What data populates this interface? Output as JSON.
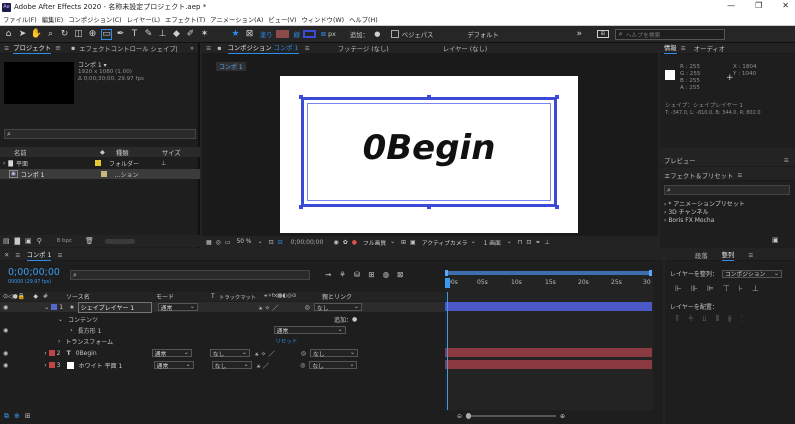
{
  "titlebar": {
    "app_icon": "Ae",
    "title": "Adobe After Effects 2020 - 名称未設定プロジェクト.aep *",
    "minimize": "—",
    "maximize": "❐",
    "close": "✕"
  },
  "menu": [
    "ファイル(F)",
    "編集(E)",
    "コンポジション(C)",
    "レイヤー(L)",
    "エフェクト(T)",
    "アニメーション(A)",
    "ビュー(V)",
    "ウィンドウ(W)",
    "ヘルプ(H)"
  ],
  "toolbar": {
    "fill_label": "塗り",
    "stroke_label": "線",
    "stroke_width": "px",
    "add_label": "追加：",
    "bezier_label": "ベジェパス",
    "workspace": "デフォルト",
    "search_placeholder": "ヘルプを検索",
    "fill_color": "#8a4a4a",
    "stroke_color": "#3b4bd8"
  },
  "project_panel": {
    "tab1": "プロジェクト",
    "tab2": "エフェクトコントロール シェイプ|",
    "comp_name": "コンポ 1 ▾",
    "comp_size": "1920 x 1080 (1.00)",
    "comp_duration": "Δ 0;00;30;00, 29.97 fps",
    "col_name": "名前",
    "col_type": "種類",
    "col_size": "サイズ",
    "items": [
      {
        "name": "平面",
        "type": "フォルダー",
        "color": "#e8c830"
      },
      {
        "name": "コンポ 1",
        "type": "...ション",
        "color": "#c8b87a"
      }
    ],
    "bpc": "8 bpc"
  },
  "comp_panel": {
    "tab_label": "コンポジション",
    "tab_name": "コンポ 1",
    "footage_tab": "フッテージ (なし)",
    "layer_tab": "レイヤー (なし)",
    "breadcrumb": "コンポ 1",
    "canvas_text": "0Begin",
    "zoom": "50 %",
    "timecode": "0;00;00;00",
    "quality": "フル画質",
    "camera": "アクティブカメラ",
    "view": "1 画面"
  },
  "info_panel": {
    "tab1": "情報",
    "tab2": "オーディオ",
    "r": "R :  255",
    "g": "G :  255",
    "b": "B :  255",
    "a": "A :  255",
    "x": "X :  1804",
    "y": "Y :  1040",
    "shape_label": "シェイプ：シェイプレイヤー 1",
    "coords": "T: -347.0,  L: -810.0,  B: 344.0,  R: 802.0"
  },
  "preview_panel": {
    "title": "プレビュー"
  },
  "effects_panel": {
    "title": "エフェクト＆プリセット",
    "items": [
      "* アニメーションプリセット",
      "3D チャンネル",
      "Boris FX Mocha"
    ]
  },
  "timeline": {
    "comp_tab": "コンポ 1",
    "timecode": "0;00;00;00",
    "timecode_sub": "00000 (29.97 fps)",
    "col_source": "ソース名",
    "col_mode": "モード",
    "col_t": "T",
    "col_trackmatte": "トラックマット",
    "col_parent": "親とリンク",
    "ruler": [
      "00s",
      "05s",
      "10s",
      "15s",
      "20s",
      "25s",
      "30"
    ],
    "contents_label": "コンテンツ",
    "add_label": "追加：",
    "rect_label": "長方形 1",
    "transform_label": "トランスフォーム",
    "reset_label": "リセット",
    "normal": "通常",
    "none": "なし",
    "layers": [
      {
        "num": "1",
        "name": "シェイプレイヤー 1",
        "mode": "通常",
        "parent": "なし",
        "color": "#5566cc",
        "track": "#4a58c8"
      },
      {
        "num": "2",
        "name": "0Begin",
        "mode": "通常",
        "matte": "なし",
        "parent": "なし",
        "color": "#c04545",
        "track": "#8a3a40"
      },
      {
        "num": "3",
        "name": "ホワイト 平面 1",
        "mode": "通常",
        "matte": "なし",
        "parent": "なし",
        "color": "#c04545",
        "track": "#8a3a40"
      }
    ]
  },
  "align_panel": {
    "tab1": "段落",
    "tab2": "整列",
    "align_to_label": "レイヤーを整列：",
    "align_to_value": "コンポジション",
    "distribute_label": "レイヤーを配置："
  }
}
